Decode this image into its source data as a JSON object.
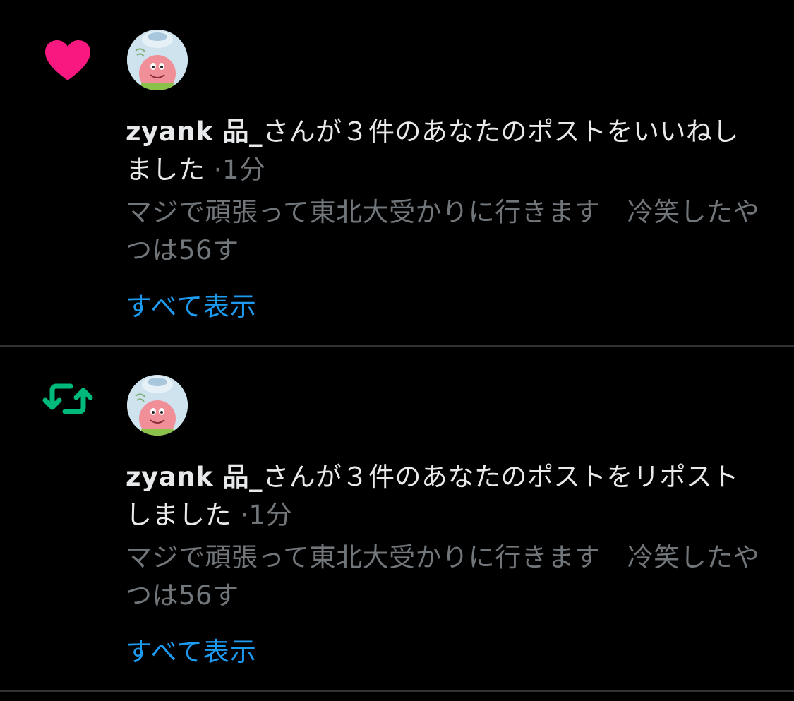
{
  "notifications": [
    {
      "type_icon": "heart-icon",
      "type_color": "#f91880",
      "user_name": "zyank 品_",
      "action_text": "さんが３件のあなたのポストをいいねしました",
      "separator": "·",
      "time": "1分",
      "preview": "マジで頑張って東北大受かりに行きます　冷笑したやつは56す",
      "show_all": "すべて表示"
    },
    {
      "type_icon": "repost-icon",
      "type_color": "#00ba7c",
      "user_name": "zyank 品_",
      "action_text": "さんが３件のあなたのポストをリポストしました",
      "separator": "·",
      "time": "1分",
      "preview": "マジで頑張って東北大受かりに行きます　冷笑したやつは56す",
      "show_all": "すべて表示"
    }
  ]
}
